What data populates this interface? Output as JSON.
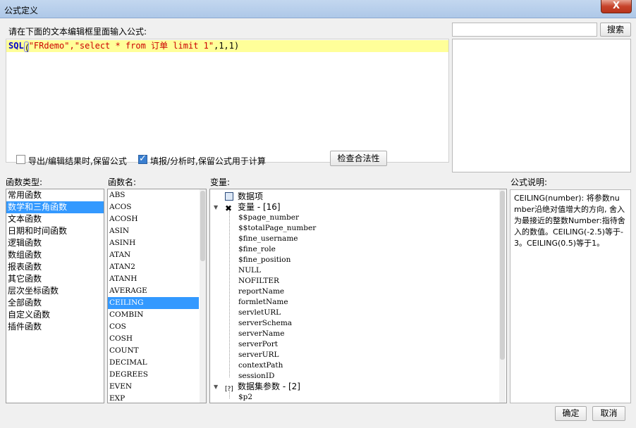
{
  "window": {
    "title": "公式定义",
    "close_glyph": "X"
  },
  "editor": {
    "label": "请在下面的文本编辑框里面输入公式:",
    "formula_fn": "SQL",
    "formula_args_str": "\"FRdemo\",\"select * from 订单 limit 1\"",
    "formula_tail": ",1,1)"
  },
  "search": {
    "value": "",
    "button": "搜索"
  },
  "options": {
    "export_keep_label": "导出/编辑结果时,保留公式",
    "export_keep_checked": false,
    "fill_keep_label": "填报/分析时,保留公式用于计算",
    "fill_keep_checked": true,
    "validate_button": "检查合法性"
  },
  "categories": {
    "label": "函数类型:",
    "items": [
      "常用函数",
      "数学和三角函数",
      "文本函数",
      "日期和时间函数",
      "逻辑函数",
      "数组函数",
      "报表函数",
      "其它函数",
      "层次坐标函数",
      "全部函数",
      "自定义函数",
      "插件函数"
    ],
    "selected": "数学和三角函数"
  },
  "functions": {
    "label": "函数名:",
    "items": [
      "ABS",
      "ACOS",
      "ACOSH",
      "ASIN",
      "ASINH",
      "ATAN",
      "ATAN2",
      "ATANH",
      "AVERAGE",
      "CEILING",
      "COMBIN",
      "COS",
      "COSH",
      "COUNT",
      "DECIMAL",
      "DEGREES",
      "EVEN",
      "EXP"
    ],
    "selected": "CEILING"
  },
  "variables": {
    "label": "变量:",
    "data_items": "数据项",
    "variable_group": "变量 - [16]",
    "variable_items": [
      "$$page_number",
      "$$totalPage_number",
      "$fine_username",
      "$fine_role",
      "$fine_position",
      "NULL",
      "NOFILTER",
      "reportName",
      "formletName",
      "servletURL",
      "serverSchema",
      "serverName",
      "serverPort",
      "serverURL",
      "contextPath",
      "sessionID"
    ],
    "param_group": "数据集参数 - [2]",
    "param_items": [
      "$p2"
    ]
  },
  "description": {
    "label": "公式说明:",
    "text": "CEILING(number): 将参数number沿绝对值增大的方向, 舍入为最接近的整数Number:指待舍入的数值。CEILING(-2.5)等于-3。CEILING(0.5)等于1。"
  },
  "footer": {
    "ok": "确定",
    "cancel": "取消"
  },
  "colors": {
    "selection": "#3399ff",
    "formula_highlight": "#ffff99",
    "keyword": "#0000cc",
    "string": "#cc0000"
  }
}
